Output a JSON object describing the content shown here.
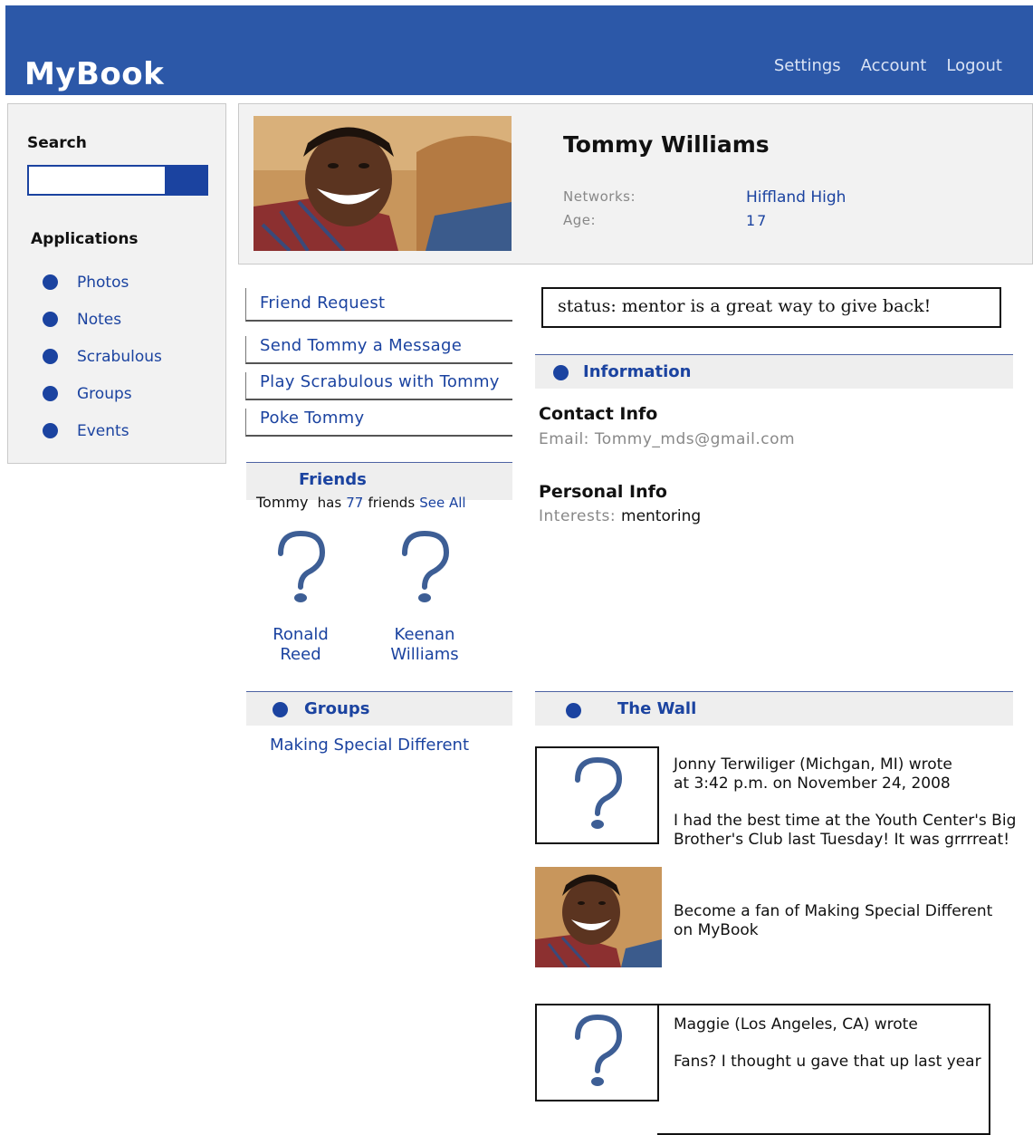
{
  "app": {
    "name": "MyBook"
  },
  "topnav": [
    "Settings",
    "Account",
    "Logout"
  ],
  "sidebar": {
    "search_label": "Search",
    "search_value": "",
    "apps_label": "Applications",
    "apps": [
      "Photos",
      "Notes",
      "Scrabulous",
      "Groups",
      "Events"
    ]
  },
  "profile": {
    "name": "Tommy Williams",
    "networks_label": "Networks:",
    "networks": "Hiffland High",
    "age_label": "Age:",
    "age": "17"
  },
  "actions": [
    "Friend Request",
    "Send Tommy a Message",
    "Play Scrabulous with Tommy",
    "Poke Tommy"
  ],
  "friends": {
    "title": "Friends",
    "owner": "Tommy",
    "has": "has",
    "count": "77",
    "friends_word": "friends",
    "see_all": "See All",
    "list": [
      {
        "first": "Ronald",
        "last": "Reed"
      },
      {
        "first": "Keenan",
        "last": "Williams"
      }
    ]
  },
  "groups": {
    "title": "Groups",
    "items": [
      "Making Special Different"
    ]
  },
  "status": "status: mentor is a great way to give back!",
  "information": {
    "title": "Information",
    "contact_heading": "Contact Info",
    "email_label": "Email:",
    "email": "Tommy_mds@gmail.com",
    "personal_heading": "Personal Info",
    "interests_label": "Interests:",
    "interests": "mentoring"
  },
  "wall": {
    "title": "The Wall",
    "posts": [
      {
        "line1": "Jonny Terwiliger (Michgan, MI) wrote",
        "line2": "at 3:42 p.m. on November 24, 2008",
        "body1": "I had the best time at the Youth Center's Big",
        "body2": "Brother's Club last Tuesday! It was grrrreat!"
      },
      {
        "line1": "Become a fan of Making Special Different",
        "line2": "on MyBook"
      },
      {
        "line1": "Maggie (Los Angeles, CA) wrote",
        "body1": "Fans? I thought u gave that up last year"
      }
    ]
  },
  "colors": {
    "brand": "#2c58a8",
    "link": "#1b43a0",
    "panel": "#f2f2f2"
  },
  "icons": [
    "question-mark-icon",
    "bullet-dot-icon",
    "profile-photo"
  ]
}
